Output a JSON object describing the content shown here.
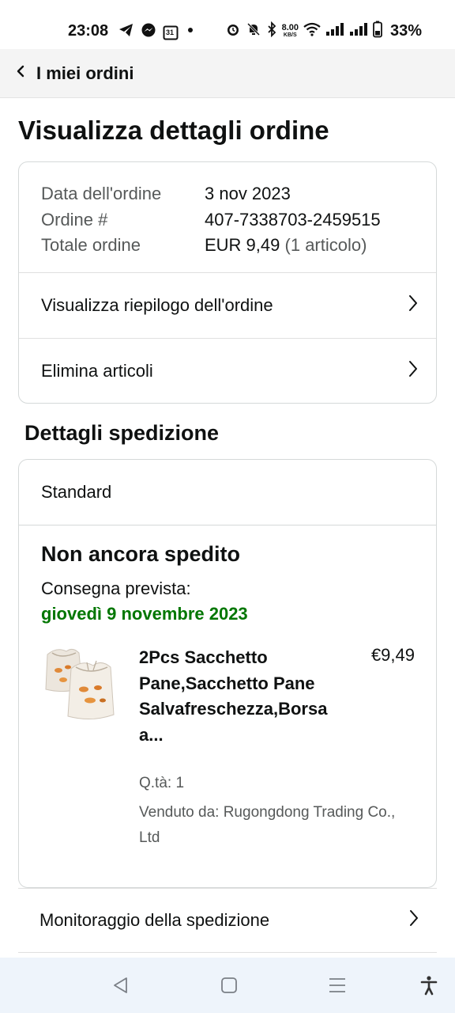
{
  "status_bar": {
    "time": "23:08",
    "net_speed_value": "8.00",
    "net_speed_unit": "KB/S",
    "battery": "33%",
    "calendar_day": "31"
  },
  "header": {
    "back_label": "I miei ordini"
  },
  "page_title": "Visualizza dettagli ordine",
  "order_info": {
    "date_label": "Data dell'ordine",
    "date_value": "3 nov 2023",
    "order_label": "Ordine #",
    "order_value": "407-7338703-2459515",
    "total_label": "Totale ordine",
    "total_value": "EUR 9,49",
    "total_items": "(1 articolo)"
  },
  "links": {
    "summary": "Visualizza riepilogo dell'ordine",
    "delete": "Elimina articoli",
    "tracking": "Monitoraggio della spedizione"
  },
  "shipping": {
    "section_title": "Dettagli spedizione",
    "method": "Standard",
    "status": "Non ancora spedito",
    "expected_label": "Consegna prevista:",
    "expected_date": "giovedì 9 novembre 2023"
  },
  "product": {
    "title": "2Pcs Sacchetto Pane,Sacchetto Pane Salvafreschezza,Borsa a...",
    "price": "€9,49",
    "qty": "Q.tà: 1",
    "seller": "Venduto da: Rugongdong Trading Co., Ltd"
  },
  "colors": {
    "delivery_green": "#007600",
    "muted_text": "#565959",
    "border": "#d5d9d9",
    "nav_bar_bg": "#eef4fb"
  },
  "icons": [
    "telegram-icon",
    "messenger-icon",
    "calendar-icon",
    "dot-icon",
    "alarm-icon",
    "mute-icon",
    "bluetooth-icon",
    "wifi-icon",
    "signal-icon",
    "battery-icon",
    "chevron-left-icon",
    "chevron-right-icon",
    "nav-back-icon",
    "nav-home-icon",
    "nav-recents-icon",
    "accessibility-icon"
  ]
}
